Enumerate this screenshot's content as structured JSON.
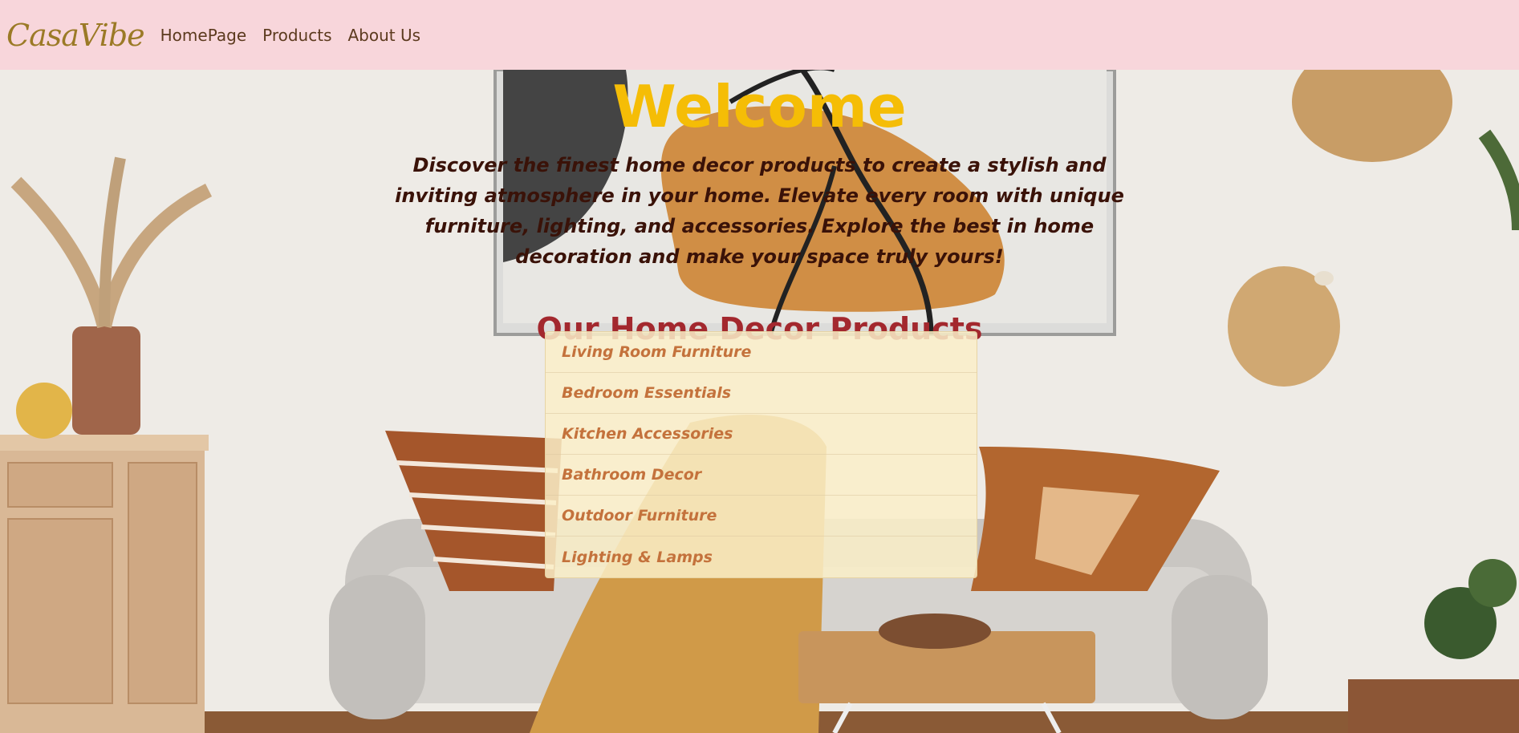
{
  "brand": {
    "name": "CasaVibe"
  },
  "nav": {
    "links": [
      "HomePage",
      "Products",
      "About Us"
    ]
  },
  "hero": {
    "title": "Welcome",
    "intro": "Discover the finest home decor products to create a stylish and inviting atmosphere in your home. Elevate every room with unique furniture, lighting, and accessories. Explore the best in home decoration and make your space truly yours!"
  },
  "products": {
    "heading": "Our Home Decor Products",
    "items": [
      "Living Room Furniture",
      "Bedroom Essentials",
      "Kitchen Accessories",
      "Bathroom Decor",
      "Outdoor Furniture",
      "Lighting & Lamps"
    ]
  },
  "colors": {
    "navbar_bg": "#f8d6db",
    "brand": "#9b7a26",
    "welcome": "#f5bd06",
    "heading": "#a3282e",
    "product_text": "#c4723c"
  }
}
